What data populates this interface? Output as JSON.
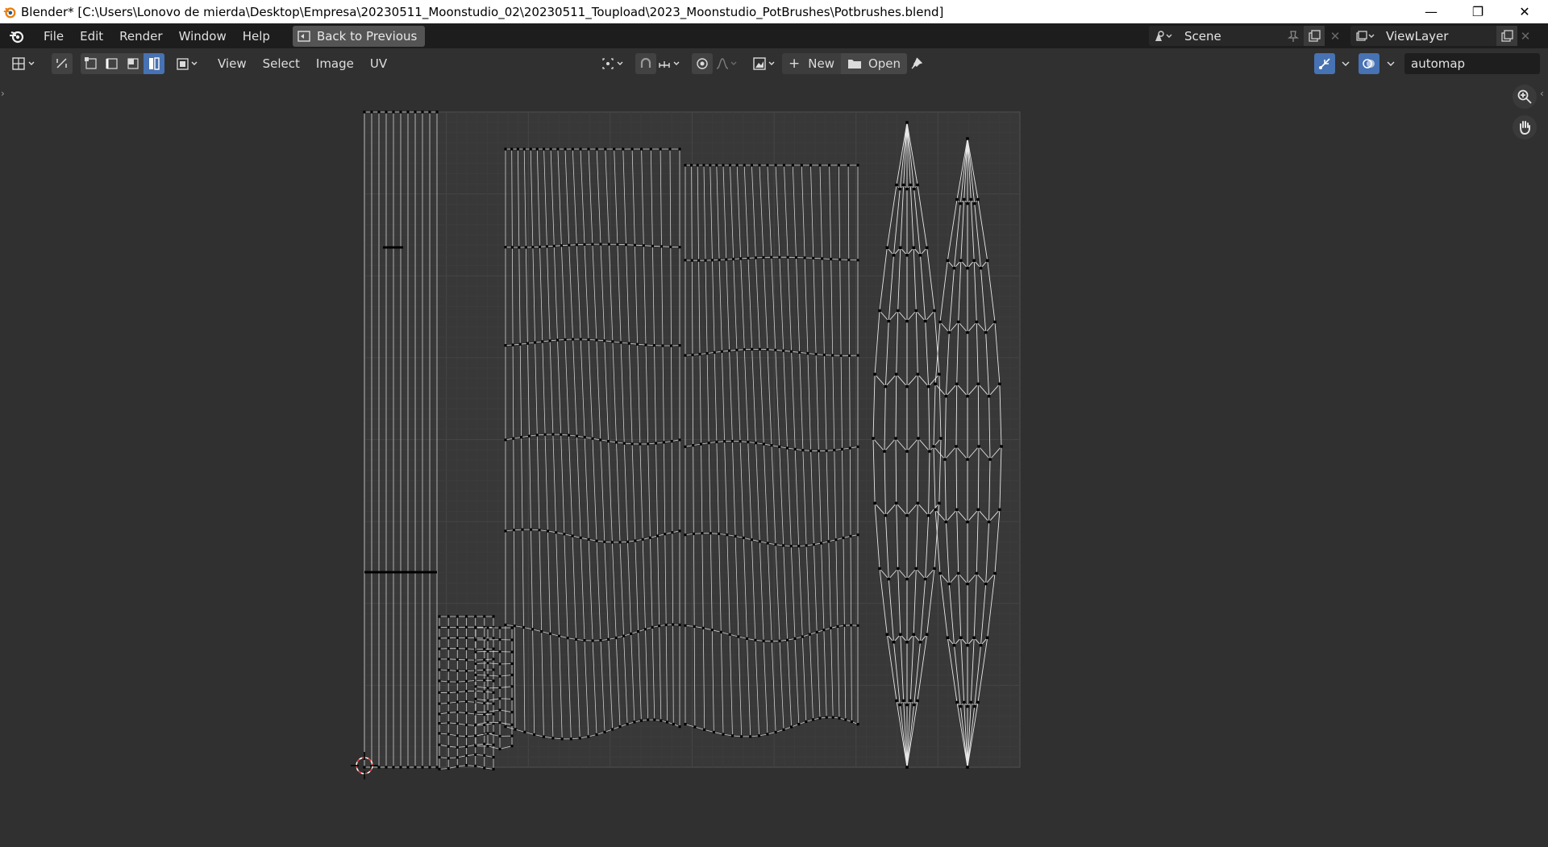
{
  "window": {
    "title": "Blender* [C:\\Users\\Lonovo de mierda\\Desktop\\Empresa\\20230511_Moonstudio_02\\20230511_Toupload\\2023_Moonstudio_PotBrushes\\Potbrushes.blend]",
    "minimize": "—",
    "maximize": "❐",
    "close": "✕"
  },
  "topbar": {
    "menus": [
      "File",
      "Edit",
      "Render",
      "Window",
      "Help"
    ],
    "back_button": "Back to Previous",
    "scene": "Scene",
    "view_layer": "ViewLayer"
  },
  "editor_header": {
    "menus": [
      "View",
      "Select",
      "Image",
      "UV"
    ],
    "new_label": "New",
    "open_label": "Open",
    "uv_map": "automap",
    "accent_color": "#4772b3"
  },
  "icons": {
    "editor_type": "uv-editor-icon",
    "sync": "sync-selection-icon",
    "select_vertex": "vertex-select-icon",
    "select_edge": "edge-select-icon",
    "select_face": "face-select-icon",
    "select_island": "island-select-icon",
    "sticky": "sticky-select-icon",
    "pivot": "pivot-point-icon",
    "snap": "snap-icon",
    "snap_target": "snap-increment-icon",
    "proportional": "proportional-edit-icon",
    "falloff": "falloff-curve-icon",
    "image_browse": "image-browse-icon",
    "pin": "pin-icon",
    "gizmo": "gizmo-icon",
    "overlay": "overlay-icon",
    "zoom": "zoom-icon",
    "hand": "hand-pan-icon",
    "cursor": "2d-cursor-icon"
  }
}
